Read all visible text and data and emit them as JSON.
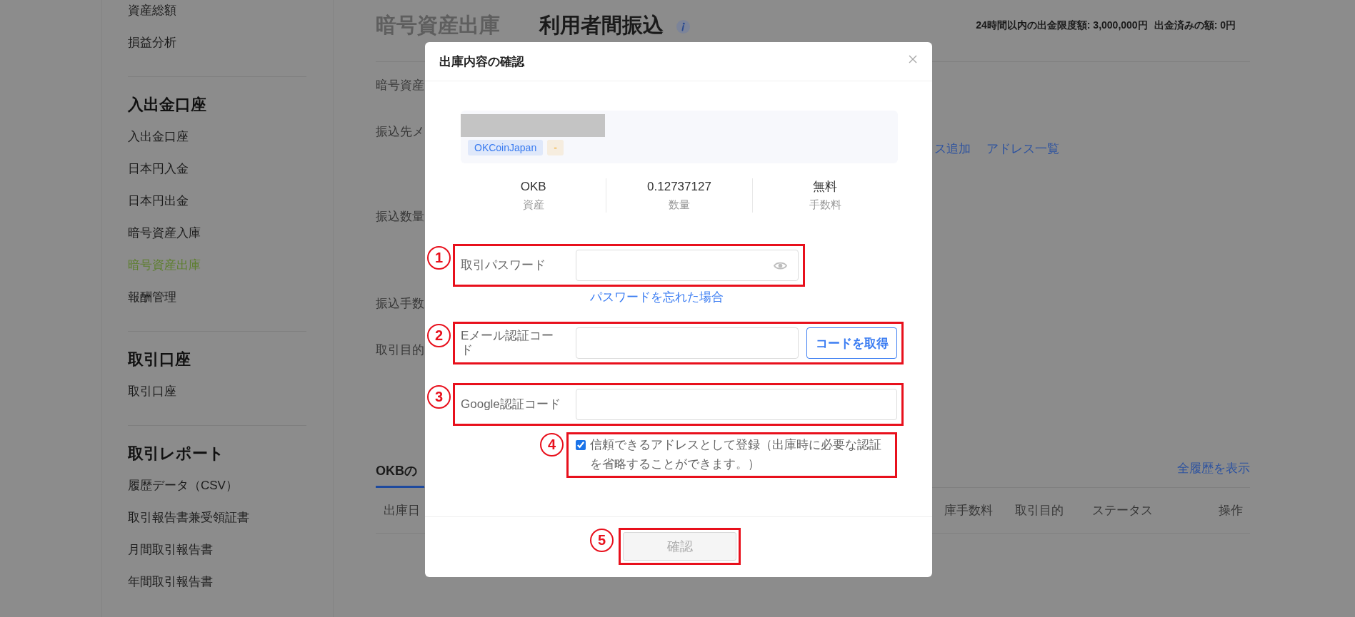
{
  "sidebar": {
    "groups": [
      {
        "items": [
          {
            "label": "資産総額",
            "selected": false
          },
          {
            "label": "損益分析",
            "selected": false
          }
        ]
      },
      {
        "title": "入出金口座",
        "items": [
          {
            "label": "入出金口座",
            "selected": false
          },
          {
            "label": "日本円入金",
            "selected": false
          },
          {
            "label": "日本円出金",
            "selected": false
          },
          {
            "label": "暗号資産入庫",
            "selected": false
          },
          {
            "label": "暗号資産出庫",
            "selected": true
          },
          {
            "label": "報酬管理",
            "selected": false
          }
        ]
      },
      {
        "title": "取引口座",
        "items": [
          {
            "label": "取引口座",
            "selected": false
          }
        ]
      },
      {
        "title": "取引レポート",
        "items": [
          {
            "label": "履歴データ（CSV）",
            "selected": false
          },
          {
            "label": "取引報告書兼受領証書",
            "selected": false
          },
          {
            "label": "月間取引報告書",
            "selected": false
          },
          {
            "label": "年間取引報告書",
            "selected": false
          }
        ]
      }
    ]
  },
  "page_header": {
    "tabs": [
      {
        "label": "暗号資産出庫",
        "selected": false
      },
      {
        "label": "利用者間振込",
        "selected": true
      }
    ],
    "limits": [
      "24時間以内の出金限度額: 3,000,000円",
      "出金済みの額: 0円"
    ]
  },
  "form": {
    "fields": [
      {
        "label": "暗号資産"
      },
      {
        "label": "振込先メ",
        "links": [
          "ス追加",
          "アドレス一覧"
        ]
      },
      {
        "label": "振込数量"
      },
      {
        "label": "振込手数"
      },
      {
        "label": "取引目的"
      }
    ]
  },
  "history": {
    "tabs": [
      {
        "label": "OKBの",
        "selected": true
      }
    ],
    "link": "全履歴を表示",
    "columns": [
      "出庫日",
      "庫手数料",
      "取引目的",
      "ステータス",
      "操作"
    ]
  },
  "dialog": {
    "title": "出庫内容の確認",
    "address": {
      "tags": [
        {
          "label": "OKCoinJapan",
          "color": "#3b7cf0"
        },
        {
          "label": "-",
          "color": "#f2a41c"
        }
      ]
    },
    "summary": [
      {
        "value": "OKB",
        "label": "資産"
      },
      {
        "value": "0.12737127",
        "label": "数量"
      },
      {
        "value": "無料",
        "label": "手数料"
      }
    ],
    "fields": [
      {
        "kind": "password",
        "marker": "1",
        "label": "取引パスワード",
        "help_link": "パスワードを忘れた場合"
      },
      {
        "kind": "code",
        "marker": "2",
        "label": "Eメール認証コード",
        "button": "コードを取得"
      },
      {
        "kind": "code",
        "marker": "3",
        "label": "Google認証コード"
      },
      {
        "kind": "checkbox",
        "marker": "4",
        "label": "信頼できるアドレスとして登録（出庫時に必要な認証を省略することができます。）",
        "checked": true
      }
    ],
    "confirm": {
      "marker": "5",
      "label": "確認",
      "disabled": true
    }
  }
}
